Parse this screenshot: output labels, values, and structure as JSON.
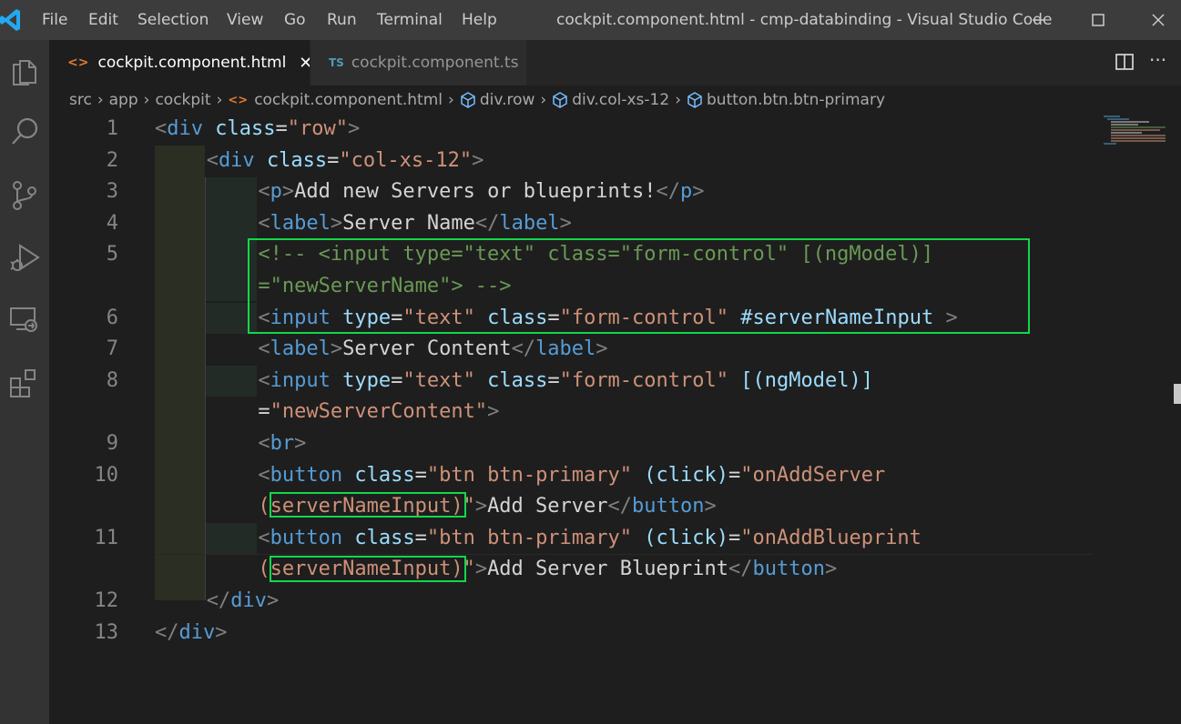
{
  "titlebar": {
    "menu": [
      "File",
      "Edit",
      "Selection",
      "View",
      "Go",
      "Run",
      "Terminal",
      "Help"
    ],
    "window_title": "cockpit.component.html - cmp-databinding - Visual Studio Code"
  },
  "tabs": [
    {
      "label": "cockpit.component.html",
      "icon": "<>",
      "active": true
    },
    {
      "label": "cockpit.component.ts",
      "icon": "TS",
      "active": false
    }
  ],
  "breadcrumb": [
    "src",
    "app",
    "cockpit",
    "cockpit.component.html",
    "div.row",
    "div.col-xs-12",
    "button.btn.btn-primary"
  ],
  "editor": {
    "line_numbers": [
      "1",
      "2",
      "3",
      "4",
      "5",
      "6",
      "7",
      "8",
      "9",
      "10",
      "11",
      "12",
      "13"
    ],
    "code_lines": [
      {
        "num": "1",
        "tokens": [
          [
            "p",
            "<"
          ],
          [
            "tag",
            "div"
          ],
          [
            "txt",
            " "
          ],
          [
            "attr",
            "class"
          ],
          [
            "txt",
            "="
          ],
          [
            "str",
            "\"row\""
          ],
          [
            "p",
            ">"
          ]
        ]
      },
      {
        "num": "2",
        "tokens": [
          [
            "p",
            "<"
          ],
          [
            "tag",
            "div"
          ],
          [
            "txt",
            " "
          ],
          [
            "attr",
            "class"
          ],
          [
            "txt",
            "="
          ],
          [
            "str",
            "\"col-xs-12\""
          ],
          [
            "p",
            ">"
          ]
        ]
      },
      {
        "num": "3",
        "tokens": [
          [
            "p",
            "<"
          ],
          [
            "tag",
            "p"
          ],
          [
            "p",
            ">"
          ],
          [
            "txt",
            "Add new Servers or blueprints!"
          ],
          [
            "p",
            "</"
          ],
          [
            "tag",
            "p"
          ],
          [
            "p",
            ">"
          ]
        ]
      },
      {
        "num": "4",
        "tokens": [
          [
            "p",
            "<"
          ],
          [
            "tag",
            "label"
          ],
          [
            "p",
            ">"
          ],
          [
            "txt",
            "Server Name"
          ],
          [
            "p",
            "</"
          ],
          [
            "tag",
            "label"
          ],
          [
            "p",
            ">"
          ]
        ]
      },
      {
        "num": "5",
        "tokens": [
          [
            "cmt",
            "<!-- <input type=\"text\" class=\"form-control\" [(ngModel)]"
          ]
        ]
      },
      {
        "num": "",
        "tokens": [
          [
            "cmt",
            "=\"newServerName\"> -->"
          ]
        ]
      },
      {
        "num": "6",
        "tokens": [
          [
            "p",
            "<"
          ],
          [
            "tag",
            "input"
          ],
          [
            "txt",
            " "
          ],
          [
            "attr",
            "type"
          ],
          [
            "txt",
            "="
          ],
          [
            "str",
            "\"text\""
          ],
          [
            "txt",
            " "
          ],
          [
            "attr",
            "class"
          ],
          [
            "txt",
            "="
          ],
          [
            "str",
            "\"form-control\""
          ],
          [
            "txt",
            " "
          ],
          [
            "attr",
            "#serverNameInput"
          ],
          [
            "txt",
            " "
          ],
          [
            "p",
            ">"
          ]
        ]
      },
      {
        "num": "7",
        "tokens": [
          [
            "p",
            "<"
          ],
          [
            "tag",
            "label"
          ],
          [
            "p",
            ">"
          ],
          [
            "txt",
            "Server Content"
          ],
          [
            "p",
            "</"
          ],
          [
            "tag",
            "label"
          ],
          [
            "p",
            ">"
          ]
        ]
      },
      {
        "num": "8",
        "tokens": [
          [
            "p",
            "<"
          ],
          [
            "tag",
            "input"
          ],
          [
            "txt",
            " "
          ],
          [
            "attr",
            "type"
          ],
          [
            "txt",
            "="
          ],
          [
            "str",
            "\"text\""
          ],
          [
            "txt",
            " "
          ],
          [
            "attr",
            "class"
          ],
          [
            "txt",
            "="
          ],
          [
            "str",
            "\"form-control\""
          ],
          [
            "txt",
            " "
          ],
          [
            "attr",
            "[(ngModel)]"
          ]
        ]
      },
      {
        "num": "",
        "tokens": [
          [
            "txt",
            "="
          ],
          [
            "str",
            "\"newServerContent\""
          ],
          [
            "p",
            ">"
          ]
        ]
      },
      {
        "num": "9",
        "tokens": [
          [
            "p",
            "<"
          ],
          [
            "tag",
            "br"
          ],
          [
            "p",
            ">"
          ]
        ]
      },
      {
        "num": "10",
        "tokens": [
          [
            "p",
            "<"
          ],
          [
            "tag",
            "button"
          ],
          [
            "txt",
            " "
          ],
          [
            "attr",
            "class"
          ],
          [
            "txt",
            "="
          ],
          [
            "str",
            "\"btn btn-primary\""
          ],
          [
            "txt",
            " "
          ],
          [
            "attr",
            "(click)"
          ],
          [
            "txt",
            "="
          ],
          [
            "str",
            "\"onAddServer"
          ]
        ]
      },
      {
        "num": "",
        "tokens": [
          [
            "str",
            "(serverNameInput)\""
          ],
          [
            "p",
            ">"
          ],
          [
            "txt",
            "Add Server"
          ],
          [
            "p",
            "</"
          ],
          [
            "tag",
            "button"
          ],
          [
            "p",
            ">"
          ]
        ]
      },
      {
        "num": "11",
        "tokens": [
          [
            "p",
            "<"
          ],
          [
            "tag",
            "button"
          ],
          [
            "txt",
            " "
          ],
          [
            "attr",
            "class"
          ],
          [
            "txt",
            "="
          ],
          [
            "str",
            "\"btn btn-primary\""
          ],
          [
            "txt",
            " "
          ],
          [
            "attr",
            "(click)"
          ],
          [
            "txt",
            "="
          ],
          [
            "str",
            "\"onAddBlueprint"
          ]
        ]
      },
      {
        "num": "",
        "tokens": [
          [
            "str",
            "(serverNameInput)\""
          ],
          [
            "p",
            ">"
          ],
          [
            "txt",
            "Add Server Blueprint"
          ],
          [
            "p",
            "</"
          ],
          [
            "tag",
            "button"
          ],
          [
            "p",
            ">"
          ]
        ]
      },
      {
        "num": "12",
        "tokens": [
          [
            "p",
            "</"
          ],
          [
            "tag",
            "div"
          ],
          [
            "p",
            ">"
          ]
        ]
      },
      {
        "num": "13",
        "tokens": [
          [
            "p",
            "</"
          ],
          [
            "tag",
            "div"
          ],
          [
            "p",
            ">"
          ]
        ]
      }
    ]
  },
  "colors": {
    "highlight_box": "#12d84a",
    "tag": "#569cd6",
    "attribute": "#9cdcfe",
    "string": "#ce9178",
    "comment": "#6a9955"
  }
}
